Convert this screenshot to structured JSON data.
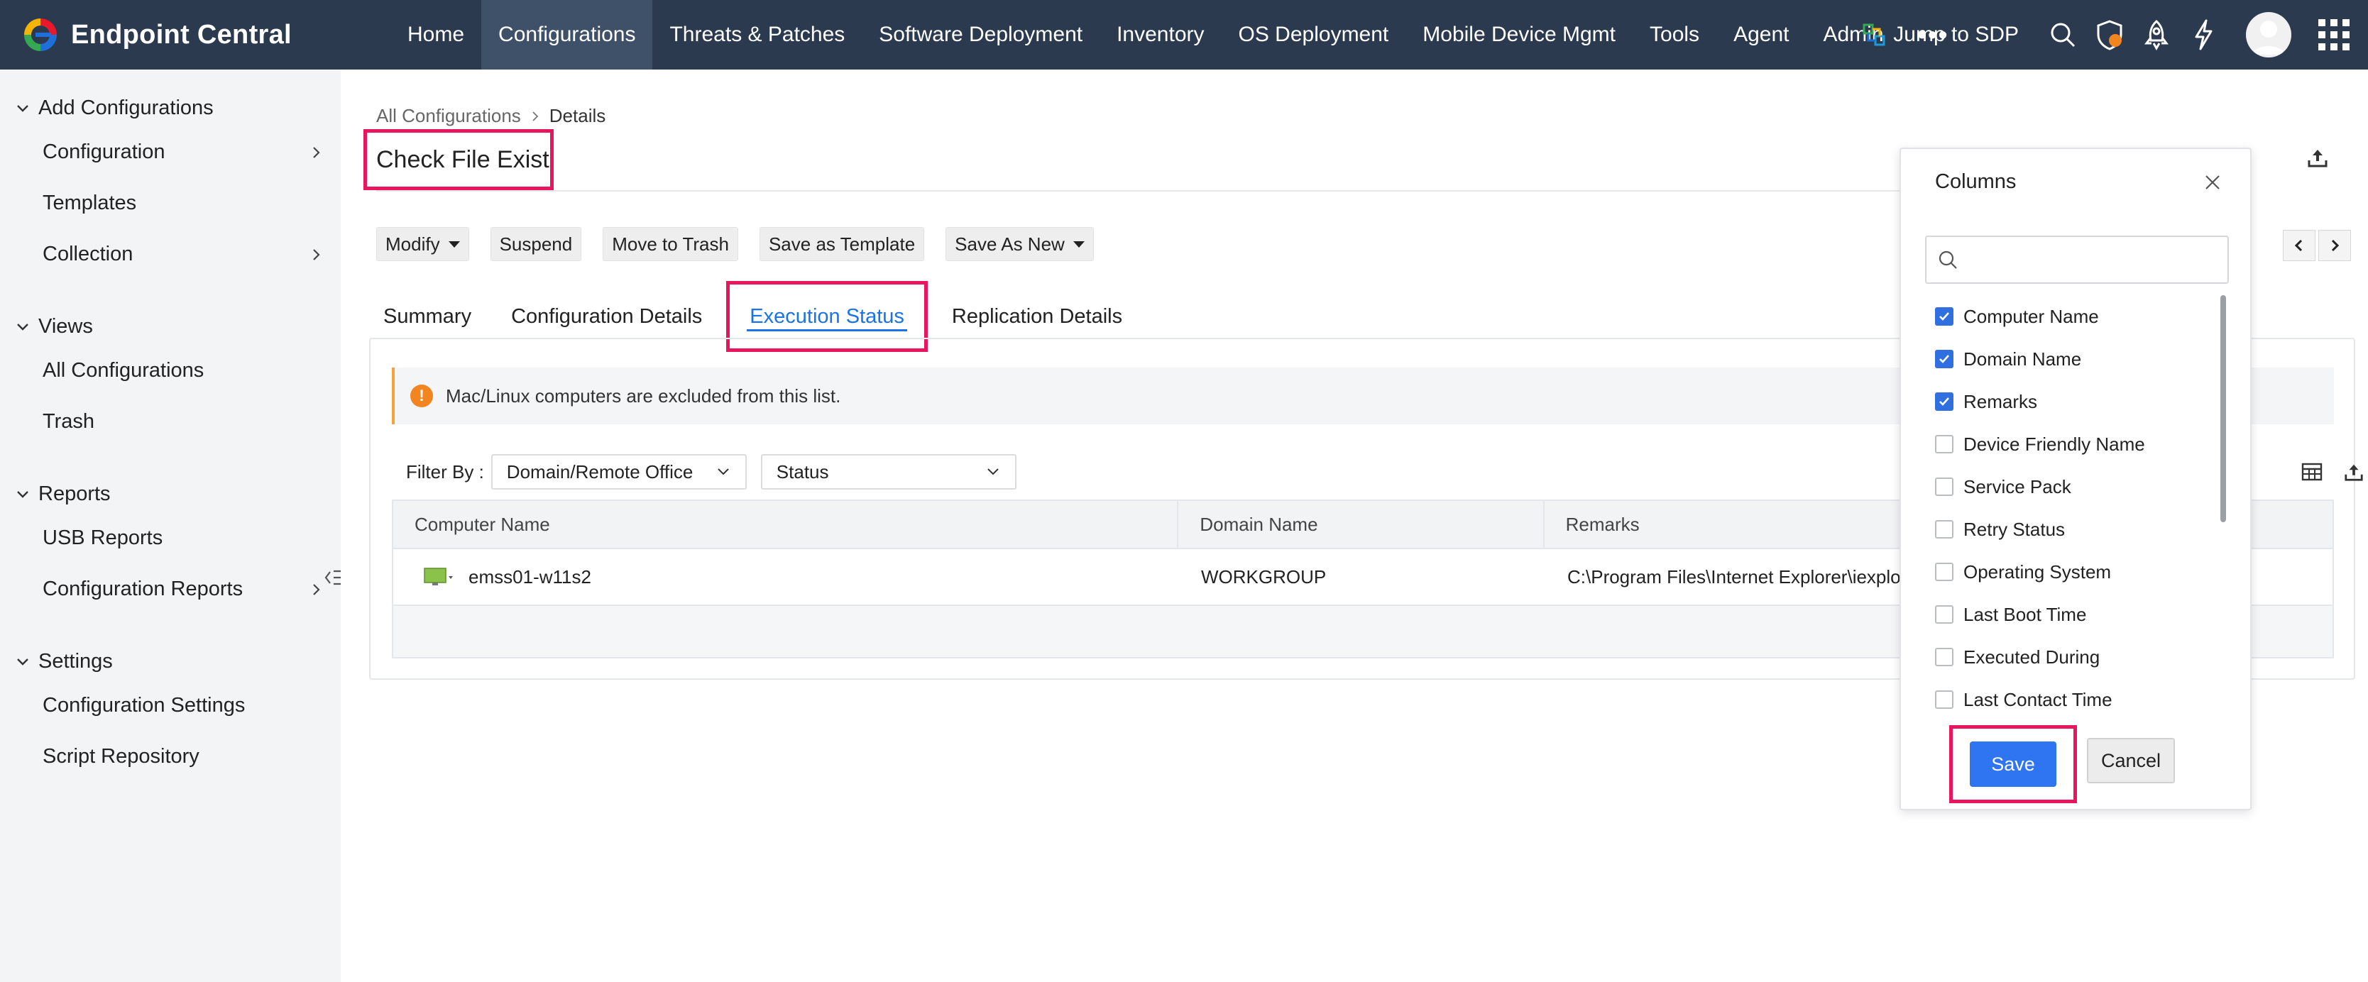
{
  "brand": {
    "name": "Endpoint Central",
    "colors": {
      "red": "#e8192c",
      "blue": "#1e6fd9",
      "green": "#34a853",
      "yellow": "#f4b400"
    }
  },
  "nav": {
    "items": [
      "Home",
      "Configurations",
      "Threats & Patches",
      "Software Deployment",
      "Inventory",
      "OS Deployment",
      "Mobile Device Mgmt",
      "Tools",
      "Agent",
      "Admin"
    ],
    "active": "Configurations",
    "more": "•••",
    "jump_label": "Jump to SDP",
    "icons": [
      "search-icon",
      "shield-alert-icon",
      "rocket-icon",
      "lightning-icon",
      "avatar",
      "apps-grid-icon"
    ]
  },
  "sidebar": {
    "sections": [
      {
        "label": "Add Configurations",
        "items": [
          {
            "label": "Configuration",
            "chevron": true
          },
          {
            "label": "Templates",
            "chevron": false
          },
          {
            "label": "Collection",
            "chevron": true
          }
        ]
      },
      {
        "label": "Views",
        "items": [
          {
            "label": "All Configurations",
            "chevron": false
          },
          {
            "label": "Trash",
            "chevron": false
          }
        ]
      },
      {
        "label": "Reports",
        "items": [
          {
            "label": "USB Reports",
            "chevron": false
          },
          {
            "label": "Configuration Reports",
            "chevron": true
          }
        ]
      },
      {
        "label": "Settings",
        "items": [
          {
            "label": "Configuration Settings",
            "chevron": false
          },
          {
            "label": "Script Repository",
            "chevron": false
          }
        ]
      }
    ]
  },
  "breadcrumb": {
    "parent": "All Configurations",
    "current": "Details"
  },
  "page_title": "Check File Exist",
  "actions": {
    "modify": "Modify",
    "suspend": "Suspend",
    "trash": "Move to Trash",
    "template": "Save as Template",
    "save_new": "Save As New"
  },
  "tabs": {
    "summary": "Summary",
    "config": "Configuration Details",
    "execution": "Execution Status",
    "replication": "Replication Details",
    "active": "Execution Status"
  },
  "notice": "Mac/Linux computers are excluded from this list.",
  "filter": {
    "label": "Filter By :",
    "domain": "Domain/Remote Office",
    "status": "Status"
  },
  "table": {
    "headers": {
      "computer": "Computer Name",
      "domain": "Domain Name",
      "remarks": "Remarks"
    },
    "rows": [
      {
        "computer": "emss01-w11s2",
        "domain": "WORKGROUP",
        "remarks": "C:\\Program Files\\Internet Explorer\\iexplo"
      }
    ]
  },
  "columns_popup": {
    "title": "Columns",
    "search_placeholder": "",
    "items": [
      {
        "label": "Computer Name",
        "checked": true
      },
      {
        "label": "Domain Name",
        "checked": true
      },
      {
        "label": "Remarks",
        "checked": true
      },
      {
        "label": "Device Friendly Name",
        "checked": false
      },
      {
        "label": "Service Pack",
        "checked": false
      },
      {
        "label": "Retry Status",
        "checked": false
      },
      {
        "label": "Operating System",
        "checked": false
      },
      {
        "label": "Last Boot Time",
        "checked": false
      },
      {
        "label": "Executed During",
        "checked": false
      },
      {
        "label": "Last Contact Time",
        "checked": false
      }
    ],
    "save": "Save",
    "cancel": "Cancel"
  },
  "highlight_color": "#e8175d",
  "accent_color": "#1a73e8"
}
